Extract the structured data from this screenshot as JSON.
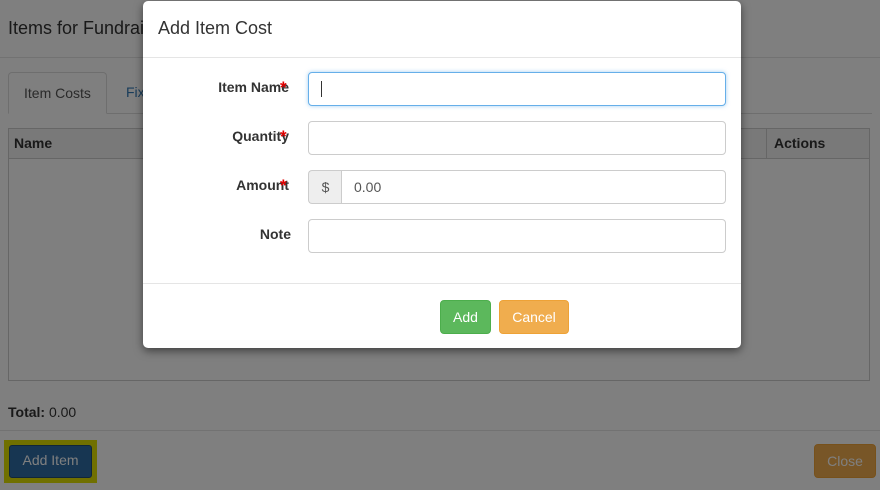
{
  "page": {
    "title": "Items for Fundrai",
    "tabs": [
      {
        "label": "Item Costs",
        "active": true
      },
      {
        "label": "Fix",
        "active": false
      }
    ],
    "table": {
      "columns": [
        "Name",
        "Actions"
      ]
    },
    "total": {
      "label": "Total:",
      "value": "0.00"
    },
    "add_item_label": "Add Item",
    "close_label": "Close"
  },
  "modal": {
    "title": "Add Item Cost",
    "required_marker": "*",
    "fields": [
      {
        "label": "Item Name",
        "required": true,
        "value": "",
        "focused": true
      },
      {
        "label": "Quantity",
        "required": true,
        "value": ""
      },
      {
        "label": "Amount",
        "required": true,
        "prefix": "$",
        "value": "0.00"
      },
      {
        "label": "Note",
        "required": false,
        "value": ""
      }
    ],
    "add_label": "Add",
    "cancel_label": "Cancel"
  },
  "colors": {
    "primary": "#2e6da4",
    "success": "#5cb85c",
    "warning": "#f0ad4e",
    "required": "#e00000",
    "highlight": "#e0e000",
    "focus": "#66afe9"
  }
}
